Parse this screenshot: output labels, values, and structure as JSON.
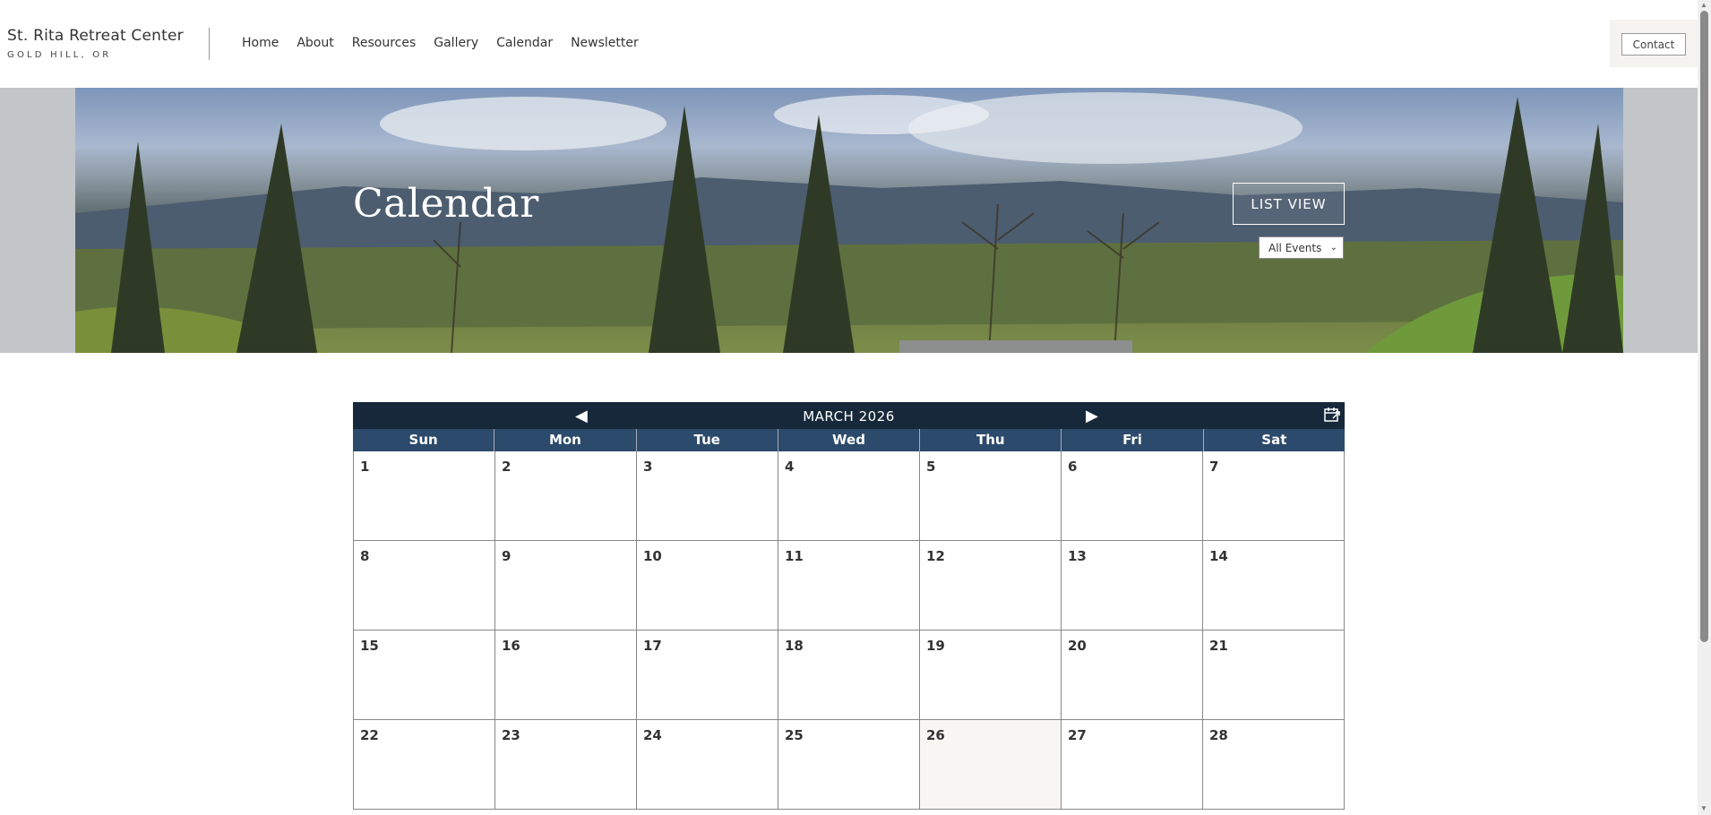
{
  "header": {
    "brand_title": "St. Rita Retreat Center",
    "brand_subtitle": "GOLD HILL, OR",
    "nav": [
      "Home",
      "About",
      "Resources",
      "Gallery",
      "Calendar",
      "Newsletter"
    ],
    "contact_label": "Contact"
  },
  "hero": {
    "title": "Calendar",
    "list_view_label": "LIST VIEW",
    "filter_selected": "All Events"
  },
  "calendar": {
    "month_label": "MARCH 2026",
    "prev_icon": "◀",
    "next_icon": "▶",
    "export_icon": "calendar-export-icon",
    "days_of_week": [
      "Sun",
      "Mon",
      "Tue",
      "Wed",
      "Thu",
      "Fri",
      "Sat"
    ],
    "weeks": [
      [
        "1",
        "2",
        "3",
        "4",
        "5",
        "6",
        "7"
      ],
      [
        "8",
        "9",
        "10",
        "11",
        "12",
        "13",
        "14"
      ],
      [
        "15",
        "16",
        "17",
        "18",
        "19",
        "20",
        "21"
      ],
      [
        "22",
        "23",
        "24",
        "25",
        "26",
        "27",
        "28"
      ]
    ],
    "today": "26"
  },
  "colors": {
    "calendar_header": "#16283a",
    "dow_header": "#2c4a6b",
    "today_bg": "#f8f6f2"
  }
}
